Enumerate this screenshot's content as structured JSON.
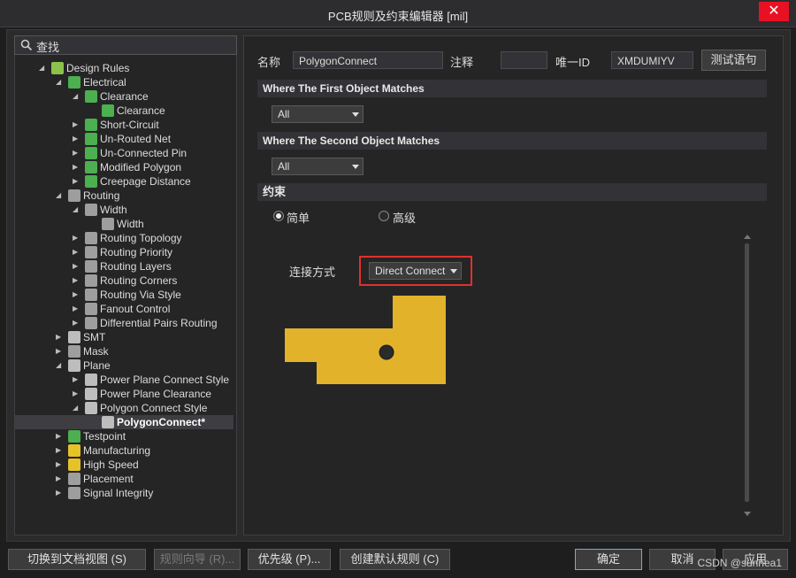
{
  "window": {
    "title": "PCB规则及约束编辑器 [mil]",
    "close_glyph": "✕"
  },
  "search": {
    "label": "查找"
  },
  "tree": [
    {
      "label": "Design Rules",
      "icon": "design-rules-icon",
      "expanded": true
    },
    {
      "label": "Electrical",
      "icon": "rule-icon",
      "expanded": true
    },
    {
      "label": "Clearance",
      "icon": "rule-icon",
      "expanded": true
    },
    {
      "label": "Clearance",
      "icon": "rule-icon"
    },
    {
      "label": "Short-Circuit",
      "icon": "rule-icon"
    },
    {
      "label": "Un-Routed Net",
      "icon": "rule-icon"
    },
    {
      "label": "Un-Connected Pin",
      "icon": "rule-icon"
    },
    {
      "label": "Modified Polygon",
      "icon": "rule-icon"
    },
    {
      "label": "Creepage Distance",
      "icon": "rule-icon"
    },
    {
      "label": "Routing",
      "icon": "routing-icon",
      "expanded": true
    },
    {
      "label": "Width",
      "icon": "routing-icon",
      "expanded": true
    },
    {
      "label": "Width",
      "icon": "routing-icon"
    },
    {
      "label": "Routing Topology",
      "icon": "routing-icon"
    },
    {
      "label": "Routing Priority",
      "icon": "routing-icon"
    },
    {
      "label": "Routing Layers",
      "icon": "routing-icon"
    },
    {
      "label": "Routing Corners",
      "icon": "routing-icon"
    },
    {
      "label": "Routing Via Style",
      "icon": "routing-icon"
    },
    {
      "label": "Fanout Control",
      "icon": "routing-icon"
    },
    {
      "label": "Differential Pairs Routing",
      "icon": "routing-icon"
    },
    {
      "label": "SMT",
      "icon": "smt-icon"
    },
    {
      "label": "Mask",
      "icon": "mask-icon"
    },
    {
      "label": "Plane",
      "icon": "plane-icon",
      "expanded": true
    },
    {
      "label": "Power Plane Connect Style",
      "icon": "plane-icon"
    },
    {
      "label": "Power Plane Clearance",
      "icon": "plane-icon"
    },
    {
      "label": "Polygon Connect Style",
      "icon": "plane-icon",
      "expanded": true
    },
    {
      "label": "PolygonConnect*",
      "icon": "plane-icon",
      "selected": true
    },
    {
      "label": "Testpoint",
      "icon": "testpoint-icon"
    },
    {
      "label": "Manufacturing",
      "icon": "manufacturing-icon"
    },
    {
      "label": "High Speed",
      "icon": "high-speed-icon"
    },
    {
      "label": "Placement",
      "icon": "placement-icon"
    },
    {
      "label": "Signal Integrity",
      "icon": "signal-integrity-icon"
    }
  ],
  "rule": {
    "name_label": "名称",
    "name_value": "PolygonConnect",
    "comment_label": "注释",
    "comment_value": "",
    "uid_label": "唯一ID",
    "uid_value": "XMDUMIYV",
    "test_button": "测试语句"
  },
  "first_match": {
    "title": "Where The First Object Matches",
    "value": "All"
  },
  "second_match": {
    "title": "Where The Second Object Matches",
    "value": "All"
  },
  "constraints": {
    "title": "约束",
    "simple_label": "简单",
    "advanced_label": "高级",
    "mode": "simple",
    "connect_label": "连接方式",
    "connect_value": "Direct Connect",
    "polygon_color": "#e2b32a",
    "pad_color": "#2b2b2b"
  },
  "footer": {
    "doc_view": "切换到文档视图 (S)",
    "wizard": "规则向导 (R)...",
    "priority": "优先级 (P)...",
    "default_rules": "创建默认规则 (C)",
    "ok": "确定",
    "cancel": "取消",
    "apply": "应用"
  },
  "watermark": "CSDN @sunnea1"
}
